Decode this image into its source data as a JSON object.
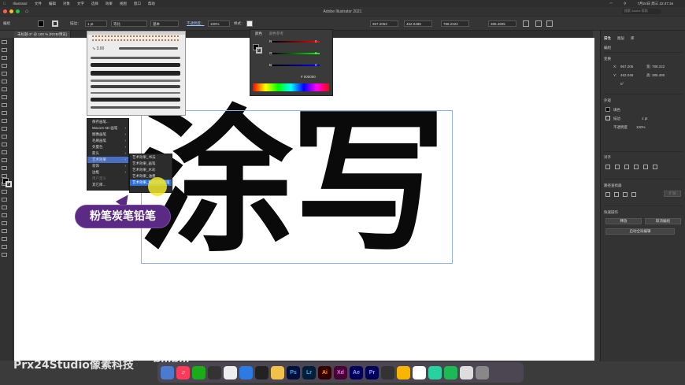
{
  "menubar": {
    "app": "Illustrator",
    "items": [
      "文件",
      "编辑",
      "对象",
      "文字",
      "选择",
      "效果",
      "视图",
      "窗口",
      "帮助"
    ],
    "clock": "7月24日 周三 22:47:16"
  },
  "window": {
    "title": "Adobe Illustrator 2021"
  },
  "control_bar": {
    "object_label": "编组",
    "stroke_label": "描边：",
    "stroke_value": "1 pt",
    "stroke_style": "等比",
    "brush_label": "基本",
    "opacity_label": "不透明度：",
    "opacity_value": "100%",
    "style_label": "样式：",
    "x_value": "967.2053",
    "y_value": "462.0488",
    "w_value": "788.2222",
    "h_value": "385.4805",
    "search_placeholder": "搜索 Adobe 帮助"
  },
  "document_tab": "未标题-2* @ 100 % (RGB/预览)",
  "canvas": {
    "big_text": "涂写"
  },
  "brush_panel": {
    "size_label": "3.00"
  },
  "brush_menu": {
    "items": [
      {
        "label": "保存画笔...",
        "arrow": false
      },
      {
        "label": "Wacom 6D 画笔",
        "arrow": true
      },
      {
        "label": "图像画笔",
        "arrow": true
      },
      {
        "label": "毛刷画笔",
        "arrow": true
      },
      {
        "label": "矢量包",
        "arrow": true
      },
      {
        "label": "箭头",
        "arrow": true
      },
      {
        "label": "艺术效果",
        "arrow": true,
        "selected": true
      },
      {
        "label": "装饰",
        "arrow": true
      },
      {
        "label": "边框",
        "arrow": true
      },
      {
        "label": "用户定义",
        "arrow": false
      },
      {
        "label": "其它库...",
        "arrow": false
      }
    ]
  },
  "submenu": {
    "items": [
      {
        "label": "艺术效果_书法"
      },
      {
        "label": "艺术效果_画笔"
      },
      {
        "label": "艺术效果_水彩"
      },
      {
        "label": "艺术效果_油墨"
      },
      {
        "label": "艺术效果_粉笔炭笔铅笔",
        "selected": true
      }
    ]
  },
  "callout": {
    "text": "粉笔炭笔铅笔"
  },
  "color_panel": {
    "tab_color": "颜色",
    "tab_guide": "颜色参考",
    "r_label": "R",
    "g_label": "G",
    "b_label": "B",
    "r_value": "0",
    "g_value": "0",
    "b_value": "0",
    "hex_value": "000000"
  },
  "right_panel": {
    "tabs": [
      "属性",
      "图层",
      "库"
    ],
    "group_label": "编组",
    "transform_header": "变换",
    "x_label": "X:",
    "x_value": "967.205",
    "y_label": "Y:",
    "y_value": "462.048",
    "w_label": "宽:",
    "w_value": "788.222",
    "h_label": "高:",
    "h_value": "385.480",
    "angle_value": "0°",
    "appearance_header": "外观",
    "fill_label": "填色",
    "stroke_label": "描边",
    "stroke_value": "1 pt",
    "opacity_label": "不透明度",
    "opacity_value": "100%",
    "align_header": "对齐",
    "pathfinder_header": "路径查找器",
    "expand_button": "扩展",
    "quick_actions_header": "快速操作",
    "ungroup_button": "释放",
    "edit_group_button": "取消编组",
    "recolor_button": "启动全局编辑"
  },
  "watermark": {
    "text": "Prx24Studio像素科技",
    "logo": "bilibili"
  },
  "colors": {
    "accent": "#5b2a84",
    "selection": "#2a6fd6",
    "cursor_highlight": "#f0e628"
  }
}
